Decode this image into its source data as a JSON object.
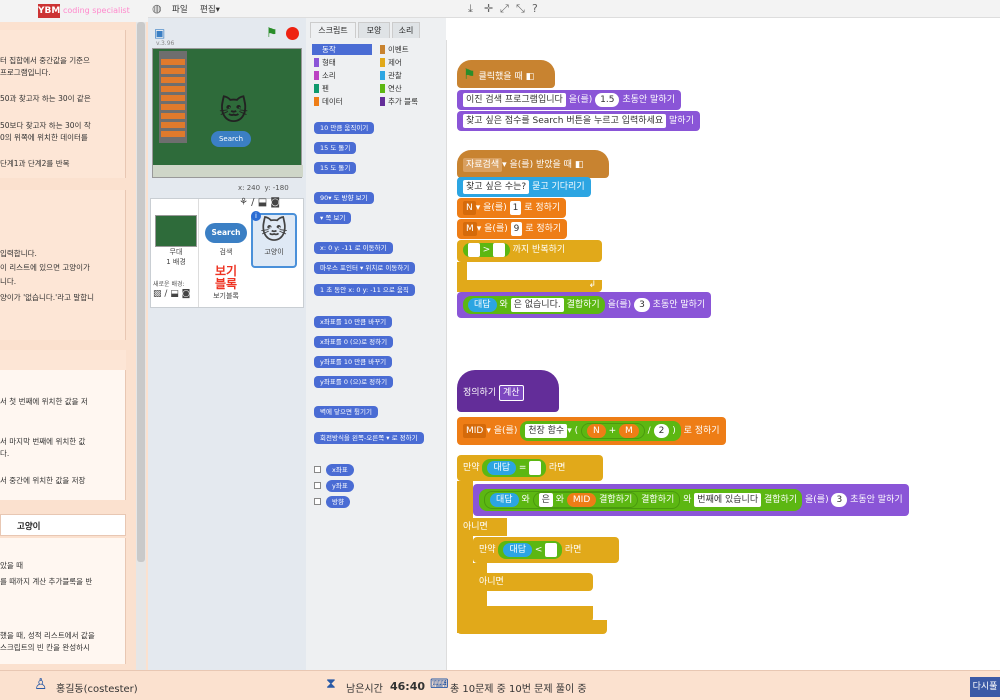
{
  "app": {
    "logo": "YBM",
    "logo_sub": "coding specialist"
  },
  "menu": {
    "file": "파일",
    "edit": "편집▾"
  },
  "left_panel": {
    "card1": [
      "터 집합에서 중간값을 기준으",
      "프로그램입니다.",
      "50과 찾고자 하는 30이 같은",
      "50보다 찾고자 하는 30이 작",
      "0의 위쪽에 위치한 데이터를",
      "단계1과 단계2를 반복"
    ],
    "card2": [
      "입력합니다.",
      "이 리스트에 있으면 고양이가",
      "니다.",
      "양이가 '없습니다.'라고 말합니"
    ],
    "card3": [
      "서 첫 번째에 위치한 값을 저",
      "서 마지막 번째에 위치한 값",
      "다.",
      "서 중간에 위치한 값을 저장"
    ],
    "tab_label": "고양이",
    "card4": [
      "았을 때",
      "를 때까지 계산 추가블록을 반",
      "했을 때, 성적 리스트에서 값을",
      "스크립트의 빈 칸을 완성하시"
    ]
  },
  "stage": {
    "search": "Search",
    "coords_x": "x: 240",
    "coords_y": "y: -180",
    "version": "v.3.96"
  },
  "sprites": {
    "stage_label": "무대",
    "stage_sub": "1 배경",
    "new_bg": "새로운 배경:",
    "search_name": "검색",
    "view_block": "보기\n블록",
    "view_block_name": "보기블록",
    "cat_name": "고양이"
  },
  "palette": {
    "tabs": [
      "스크립트",
      "모양",
      "소리"
    ],
    "categories_left": [
      "동작",
      "형태",
      "소리",
      "펜",
      "데이터"
    ],
    "categories_right": [
      "이벤트",
      "제어",
      "관찰",
      "연산",
      "추가 블록"
    ],
    "cat_colors_left": [
      "#4a6cd4",
      "#8a55d7",
      "#bb42c3",
      "#0e9a6c",
      "#ee7d16"
    ],
    "cat_colors_right": [
      "#c88330",
      "#e1a91a",
      "#2ca5e2",
      "#5cb712",
      "#632d99"
    ],
    "blocks": [
      "10 만큼 움직이기",
      "15 도 돌기",
      "15 도 돌기",
      "90▾ 도 방향 보기",
      "▾ 쪽 보기",
      "x: 0 y: -11 로 이동하기",
      "마우스 포인터 ▾ 위치로 이동하기",
      "1 초 동안 x: 0 y: -11 으로 움직",
      "x좌표를 10 만큼 바꾸기",
      "x좌표를 0 (으)로 정하기",
      "y좌표를 10 만큼 바꾸기",
      "y좌표를 0 (으)로 정하기",
      "벽에 닿으면 튕기기",
      "회전방식을 왼쪽-오른쪽 ▾ 로 정하기"
    ],
    "reporters": [
      "x좌표",
      "y좌표",
      "방향"
    ]
  },
  "scripts": {
    "hat1": "클릭했을 때",
    "say1_text": "이진 검색 프로그램입니다",
    "say1_mid": "을(를)",
    "say1_num": "1.5",
    "say1_end": "초동안 말하기",
    "say2_text": "찾고 싶은 점수를 Search 버튼을 누르고 입력하세요",
    "say2_end": "말하기",
    "hat2_name": "자료검색",
    "hat2_end": "을(를) 받았을 때",
    "ask_text": "찾고 싶은 수는?",
    "ask_end": "묻고 기다리기",
    "setN_var": "N",
    "setN_mid": "을(를)",
    "setN_val": "1",
    "setN_end": "로 정하기",
    "setM_var": "M",
    "setM_mid": "을(를)",
    "setM_val": "9",
    "setM_end": "로 정하기",
    "until_gt": ">",
    "until_end": "까지 반복하기",
    "join_ans": "대답",
    "join_and": "와",
    "join_text": "은 없습니다.",
    "join_end": "결합하기",
    "say3_mid": "을(를)",
    "say3_num": "3",
    "say3_end": "초동안 말하기",
    "define": "정의하기",
    "define_name": "계산",
    "mid_var": "MID",
    "mid_mid": "을(를)",
    "mid_func": "천장 함수",
    "mid_paren": "(",
    "mid_N": "N",
    "mid_plus": "+",
    "mid_M": "M",
    "mid_div": "/",
    "mid_two": "2",
    "mid_close": ")",
    "mid_end": "로 정하기",
    "if1": "만약",
    "if1_ans": "대답",
    "if1_eq": "=",
    "if1_then": "라면",
    "say4_ans": "대답",
    "say4_and": "와",
    "say4_eun": "은",
    "say4_and2": "와",
    "say4_mid": "MID",
    "say4_join": "결합하기",
    "say4_join2": "결합하기",
    "say4_and3": "와",
    "say4_text": "번째에 있습니다",
    "say4_join3": "결합하기",
    "say4_mid2": "을(를)",
    "say4_num": "3",
    "say4_end": "초동안 말하기",
    "else1": "아니면",
    "if2": "만약",
    "if2_ans": "대답",
    "if2_lt": "<",
    "if2_then": "라면",
    "else2": "아니면"
  },
  "footer": {
    "user": "홍길동(costester)",
    "time_label": "남은시간",
    "time": "46:40",
    "progress": "총 10문제 중 10번 문제 풀이 중",
    "retry": "다시풀"
  }
}
